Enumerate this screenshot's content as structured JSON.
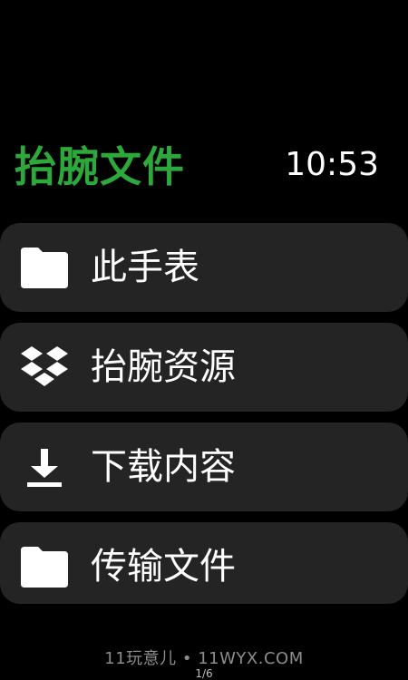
{
  "header": {
    "title": "抬腕文件",
    "time": "10:53"
  },
  "colors": {
    "accent": "#2da83a",
    "item_background": "#242424",
    "background": "#000000",
    "text": "#ffffff"
  },
  "menu": {
    "items": [
      {
        "label": "此手表",
        "icon": "folder-icon"
      },
      {
        "label": "抬腕资源",
        "icon": "dropbox-icon"
      },
      {
        "label": "下载内容",
        "icon": "download-icon"
      },
      {
        "label": "传输文件",
        "icon": "folder-icon"
      }
    ]
  },
  "watermark": "11玩意儿 • 11WYX.COM",
  "pager": "1/6"
}
